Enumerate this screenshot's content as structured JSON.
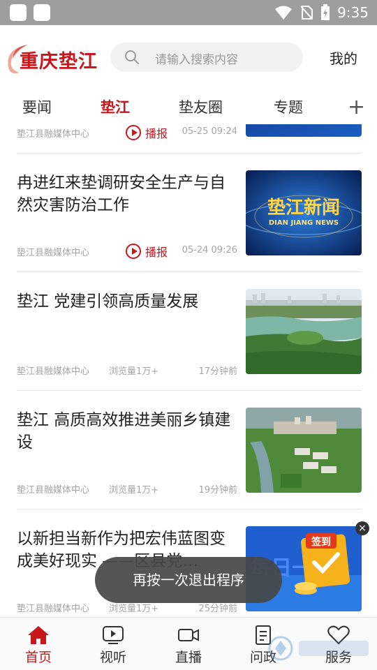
{
  "status_bar": {
    "time": "9:35"
  },
  "header": {
    "logo_text": "重庆垫江",
    "search_placeholder": "请输入搜索内容",
    "mine_label": "我的"
  },
  "tabs": [
    {
      "label": "要闻",
      "active": false
    },
    {
      "label": "垫江",
      "active": true
    },
    {
      "label": "垫友圈",
      "active": false
    },
    {
      "label": "专题",
      "active": false
    }
  ],
  "partial_item": {
    "source": "垫江县融媒体中心",
    "play_label": "播报",
    "time": "05-25 09:24"
  },
  "feed": [
    {
      "title": "冉进红来垫调研安全生产与自然灾害防治工作",
      "source": "垫江县融媒体中心",
      "play_label": "播报",
      "time": "05-24 09:26",
      "thumb_text": "垫江新闻",
      "thumb_sub": "DIAN JIANG NEWS"
    },
    {
      "title": "垫江 党建引领高质量发展",
      "source": "垫江县融媒体中心",
      "views": "浏览量1万+",
      "time": "17分钟前"
    },
    {
      "title": "垫江 高质高效推进美丽乡镇建设",
      "source": "垫江县融媒体中心",
      "views": "浏览量1万+",
      "time": "19分钟前"
    },
    {
      "title": "以新担当新作为把宏伟蓝图变成美好现实 ——区县党…",
      "source": "垫江县融媒体中心",
      "views": "浏览量1万+",
      "time": "25分钟前",
      "thumb_text": "每日一问",
      "ad_badge": "签到"
    }
  ],
  "toast": "再按一次退出程序",
  "bottom_nav": [
    {
      "label": "首页",
      "icon": "home-icon",
      "active": true
    },
    {
      "label": "视听",
      "icon": "video-icon",
      "active": false
    },
    {
      "label": "直播",
      "icon": "camera-icon",
      "active": false
    },
    {
      "label": "问政",
      "icon": "document-icon",
      "active": false
    },
    {
      "label": "服务",
      "icon": "heart-icon",
      "active": false
    }
  ],
  "colors": {
    "brand": "#c8161d",
    "status_bar": "#9e9e9e"
  }
}
